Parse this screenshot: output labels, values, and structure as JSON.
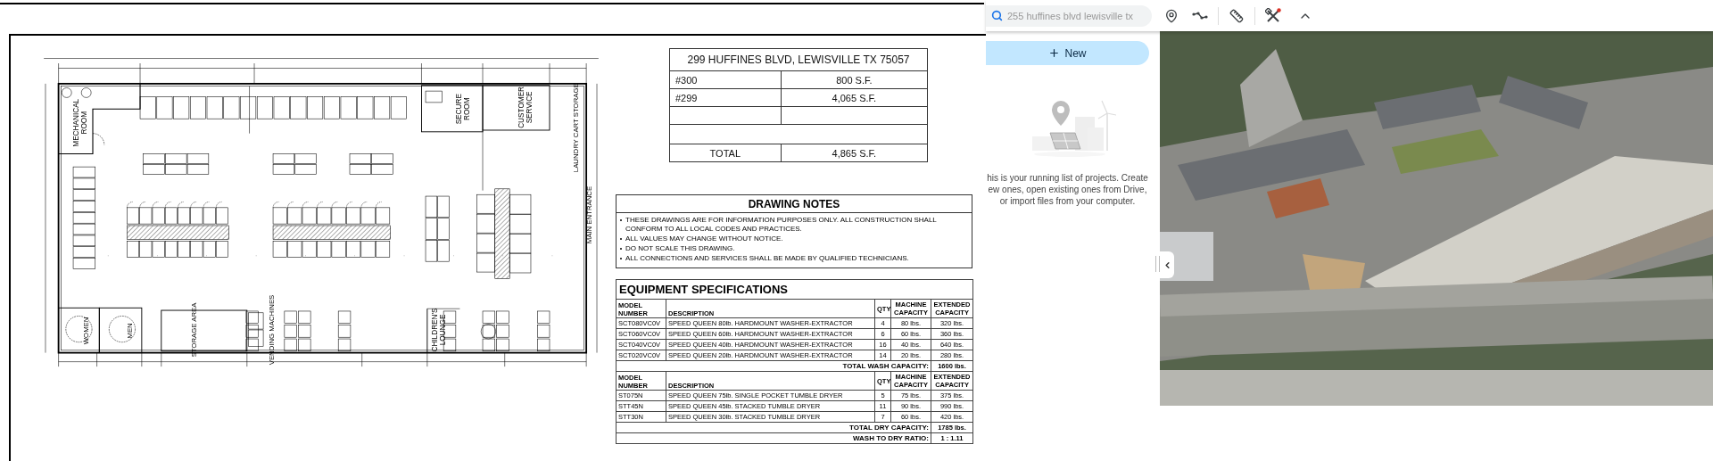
{
  "floor_plan": {
    "labels": [
      {
        "kind": "room",
        "text": "MECHANICAL ROOM"
      },
      {
        "kind": "room",
        "text": "SECURE ROOM"
      },
      {
        "kind": "room",
        "text": "CUSTOMER SERVICE"
      },
      {
        "kind": "room",
        "text": "CHILDREN'S LOUNGE"
      },
      {
        "kind": "note",
        "text": "STORAGE AREA"
      },
      {
        "kind": "note",
        "text": "VENDING MACHINES"
      },
      {
        "kind": "note",
        "text": "LAUNDRY CART STORAGE"
      },
      {
        "kind": "note",
        "text": "MAIN ENTRANCE"
      },
      {
        "kind": "note",
        "text": "WOMEN"
      },
      {
        "kind": "note",
        "text": "MEN"
      }
    ]
  },
  "address_table": {
    "title": "299 HUFFINES BLVD, LEWISVILLE TX 75057",
    "rows": [
      {
        "unit": "#300",
        "area": "800 S.F."
      },
      {
        "unit": "#299",
        "area": "4,065 S.F."
      }
    ],
    "total": {
      "label": "TOTAL",
      "area": "4,865 S.F."
    }
  },
  "drawing_notes": {
    "title": "DRAWING NOTES",
    "items": [
      "THESE DRAWINGS ARE FOR INFORMATION PURPOSES ONLY. ALL CONSTRUCTION SHALL CONFORM TO ALL LOCAL CODES AND PRACTICES.",
      "ALL VALUES MAY CHANGE WITHOUT NOTICE.",
      "DO NOT SCALE THIS DRAWING.",
      "ALL CONNECTIONS AND SERVICES SHALL BE MADE BY QUALIFIED TECHNICIANS."
    ]
  },
  "equipment_specifications": {
    "title": "EQUIPMENT SPECIFICATIONS",
    "sections": [
      {
        "columns": [
          "MODEL NUMBER",
          "DESCRIPTION",
          "QTY",
          "MACHINE CAPACITY",
          "EXTENDED CAPACITY"
        ],
        "rows": [
          {
            "model": "SCT080VC0V",
            "description": "SPEED QUEEN 80lb. HARDMOUNT WASHER-EXTRACTOR",
            "qty": "4",
            "machine": "80 lbs.",
            "extended": "320 lbs."
          },
          {
            "model": "SCT060VC0V",
            "description": "SPEED QUEEN 60lb. HARDMOUNT WASHER-EXTRACTOR",
            "qty": "6",
            "machine": "60 lbs.",
            "extended": "360 lbs."
          },
          {
            "model": "SCT040VC0V",
            "description": "SPEED QUEEN 40lb. HARDMOUNT WASHER-EXTRACTOR",
            "qty": "16",
            "machine": "40 lbs.",
            "extended": "640 lbs."
          },
          {
            "model": "SCT020VC0V",
            "description": "SPEED QUEEN 20lb. HARDMOUNT WASHER-EXTRACTOR",
            "qty": "14",
            "machine": "20 lbs.",
            "extended": "280 lbs."
          }
        ],
        "total_label": "TOTAL WASH CAPACITY:",
        "total_value": "1600 lbs."
      },
      {
        "columns": [
          "MODEL NUMBER",
          "DESCRIPTION",
          "QTY",
          "MACHINE CAPACITY",
          "EXTENDED CAPACITY"
        ],
        "rows": [
          {
            "model": "ST075N",
            "description": "SPEED QUEEN 75lb. SINGLE POCKET TUMBLE DRYER",
            "qty": "5",
            "machine": "75 lbs.",
            "extended": "375 lbs."
          },
          {
            "model": "STT45N",
            "description": "SPEED QUEEN 45lb. STACKED TUMBLE DRYER",
            "qty": "11",
            "machine": "90 lbs.",
            "extended": "990 lbs."
          },
          {
            "model": "STT30N",
            "description": "SPEED QUEEN 30lb. STACKED TUMBLE DRYER",
            "qty": "7",
            "machine": "60 lbs.",
            "extended": "420 lbs."
          }
        ],
        "total_label": "TOTAL DRY CAPACITY:",
        "total_value": "1785 lbs."
      }
    ],
    "ratio_label": "WASH TO DRY RATIO:",
    "ratio_value": "1 : 1.11"
  },
  "earth": {
    "search": {
      "value": "255 huffines blvd lewisville tx"
    },
    "new_button": "New",
    "empty_message": [
      "his is your running list of projects. Create",
      "ew ones, open existing ones from Drive,",
      "or import files from your computer."
    ]
  }
}
